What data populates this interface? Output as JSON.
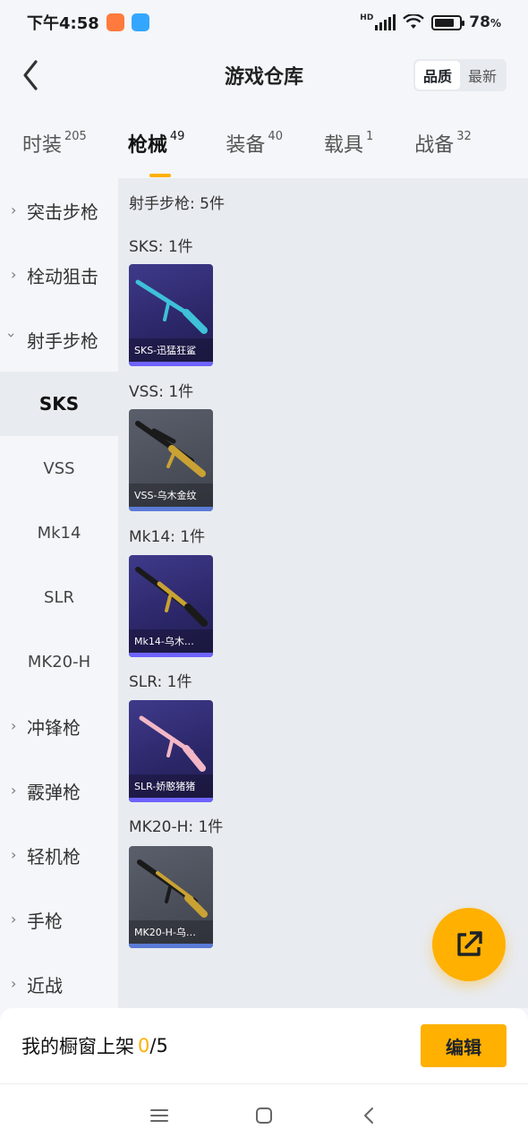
{
  "status_bar": {
    "time": "下午4:58",
    "hd": "HD",
    "battery": "78",
    "battery_unit": "%"
  },
  "header": {
    "title": "游戏仓库",
    "sort_options": [
      "品质",
      "最新"
    ],
    "active_sort": "品质"
  },
  "tabs": [
    {
      "label": "时装",
      "count": "205"
    },
    {
      "label": "枪械",
      "count": "49",
      "active": true
    },
    {
      "label": "装备",
      "count": "40"
    },
    {
      "label": "载具",
      "count": "1"
    },
    {
      "label": "战备",
      "count": "32"
    }
  ],
  "sidebar": {
    "items": [
      {
        "label": "突击步枪",
        "type": "category",
        "expanded": false
      },
      {
        "label": "栓动狙击",
        "type": "category",
        "expanded": false
      },
      {
        "label": "射手步枪",
        "type": "category",
        "expanded": true
      },
      {
        "label": "SKS",
        "type": "sub",
        "selected": true
      },
      {
        "label": "VSS",
        "type": "sub"
      },
      {
        "label": "Mk14",
        "type": "sub"
      },
      {
        "label": "SLR",
        "type": "sub"
      },
      {
        "label": "MK20-H",
        "type": "sub"
      },
      {
        "label": "冲锋枪",
        "type": "category",
        "expanded": false
      },
      {
        "label": "霰弹枪",
        "type": "category",
        "expanded": false
      },
      {
        "label": "轻机枪",
        "type": "category",
        "expanded": false
      },
      {
        "label": "手枪",
        "type": "category",
        "expanded": false
      },
      {
        "label": "近战",
        "type": "category",
        "expanded": false
      }
    ]
  },
  "main": {
    "heading": "射手步枪: 5件",
    "groups": [
      {
        "label": "SKS: 1件",
        "item": {
          "name": "SKS-迅猛狂鲨",
          "rarity_color": "#6e63ff",
          "weapon_color": "#3ec1d9",
          "icon": "rifle-icon"
        }
      },
      {
        "label": "VSS: 1件",
        "item": {
          "name": "VSS-乌木金纹",
          "rarity_color": "#5b7bd6",
          "weapon_color": "#c9a233",
          "icon": "rifle-icon"
        }
      },
      {
        "label": "Mk14: 1件",
        "item": {
          "name": "Mk14-乌木…",
          "rarity_color": "#6e63ff",
          "weapon_color": "#c9a233",
          "icon": "rifle-icon"
        }
      },
      {
        "label": "SLR: 1件",
        "item": {
          "name": "SLR-娇憨猪猪",
          "rarity_color": "#6e63ff",
          "weapon_color": "#f3b7c6",
          "icon": "rifle-icon"
        }
      },
      {
        "label": "MK20-H: 1件",
        "item": {
          "name": "MK20-H-乌…",
          "rarity_color": "#5b7bd6",
          "weapon_color": "#c9a233",
          "icon": "rifle-icon"
        }
      }
    ]
  },
  "fab": {
    "icon": "share-external-icon"
  },
  "bottom_bar": {
    "label": "我的橱窗上架",
    "current": "0",
    "separator": "/",
    "total": "5",
    "edit_label": "编辑"
  },
  "navbar": {
    "icons": [
      "menu-icon",
      "home-square-icon",
      "back-icon"
    ]
  },
  "colors": {
    "accent": "#ffb000"
  }
}
